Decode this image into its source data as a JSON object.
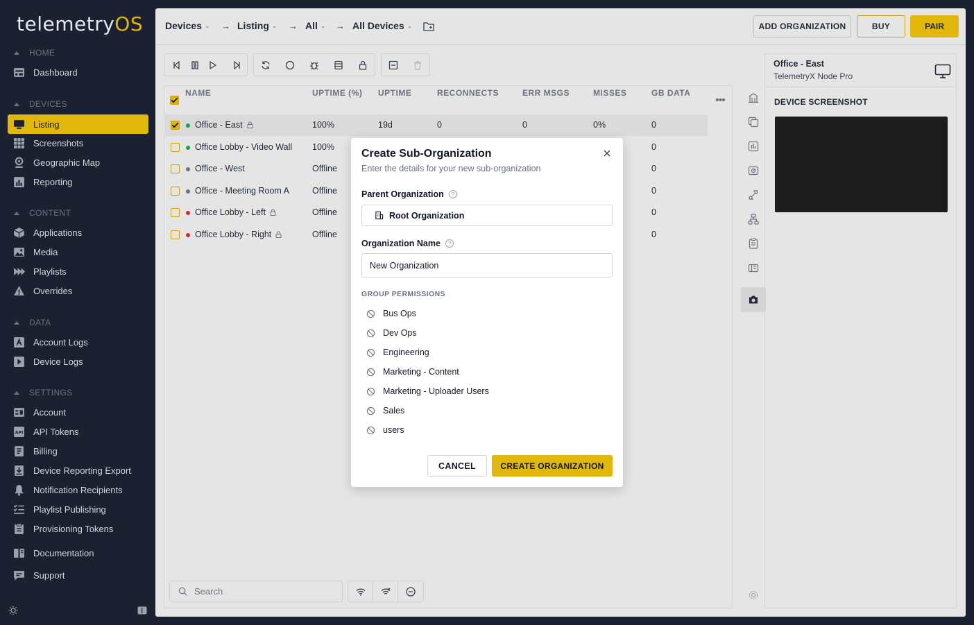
{
  "app": {
    "logo_main": "telemetry",
    "logo_accent": "OS",
    "accent_color": "#e2b70c"
  },
  "sidebar": {
    "sections": {
      "home": "HOME",
      "devices": "DEVICES",
      "content": "CONTENT",
      "data": "DATA",
      "settings": "SETTINGS"
    },
    "items": {
      "dashboard": "Dashboard",
      "listing": "Listing",
      "screenshots": "Screenshots",
      "geo_map": "Geographic Map",
      "reporting": "Reporting",
      "applications": "Applications",
      "media": "Media",
      "playlists": "Playlists",
      "overrides": "Overrides",
      "account_logs": "Account Logs",
      "device_logs": "Device Logs",
      "account": "Account",
      "api_tokens": "API Tokens",
      "billing": "Billing",
      "device_reporting_export": "Device Reporting Export",
      "notification_recipients": "Notification Recipients",
      "playlist_publishing": "Playlist Publishing",
      "provisioning_tokens": "Provisioning Tokens",
      "documentation": "Documentation",
      "support": "Support"
    }
  },
  "header": {
    "breadcrumbs": [
      "Devices",
      "Listing",
      "All",
      "All Devices"
    ],
    "add_org": "ADD ORGANIZATION",
    "buy": "BUY",
    "pair": "PAIR"
  },
  "table": {
    "columns": [
      "NAME",
      "UPTIME (%)",
      "UPTIME",
      "RECONNECTS",
      "ERR MSGS",
      "MISSES",
      "GB DATA"
    ],
    "rows": [
      {
        "name": "Office - East",
        "status": "online",
        "uptime_pct": "100%",
        "uptime": "19d",
        "reconnects": "0",
        "err": "0",
        "misses": "0%",
        "gb": "0",
        "locked": true,
        "selected": true
      },
      {
        "name": "Office Lobby - Video Wall",
        "status": "online",
        "uptime_pct": "100%",
        "uptime": "",
        "reconnects": "",
        "err": "",
        "misses": "",
        "gb": "0",
        "locked": false,
        "selected": false
      },
      {
        "name": "Office - West",
        "status": "offline",
        "uptime_pct": "Offline",
        "uptime": "",
        "reconnects": "",
        "err": "",
        "misses": "",
        "gb": "0",
        "locked": false,
        "selected": false
      },
      {
        "name": "Office - Meeting Room A",
        "status": "offline",
        "uptime_pct": "Offline",
        "uptime": "",
        "reconnects": "",
        "err": "",
        "misses": "",
        "gb": "0",
        "locked": false,
        "selected": false
      },
      {
        "name": "Office Lobby - Left",
        "status": "error",
        "uptime_pct": "Offline",
        "uptime": "",
        "reconnects": "",
        "err": "",
        "misses": "",
        "gb": "0",
        "locked": true,
        "selected": false
      },
      {
        "name": "Office Lobby - Right",
        "status": "error",
        "uptime_pct": "Offline",
        "uptime": "",
        "reconnects": "",
        "err": "",
        "misses": "",
        "gb": "0",
        "locked": true,
        "selected": false
      }
    ],
    "search_placeholder": "Search"
  },
  "device_panel": {
    "title": "Office - East",
    "subtitle": "TelemetryX Node Pro",
    "section": "DEVICE SCREENSHOT"
  },
  "modal": {
    "title": "Create Sub-Organization",
    "subtitle": "Enter the details for your new sub-organization",
    "parent_label": "Parent Organization",
    "parent_value": "Root Organization",
    "name_label": "Organization Name",
    "name_value": "New Organization",
    "group_heading": "GROUP PERMISSIONS",
    "permissions": [
      "Bus Ops",
      "Dev Ops",
      "Engineering",
      "Marketing - Content",
      "Marketing - Uploader Users",
      "Sales",
      "users"
    ],
    "cancel": "CANCEL",
    "create": "CREATE ORGANIZATION"
  }
}
